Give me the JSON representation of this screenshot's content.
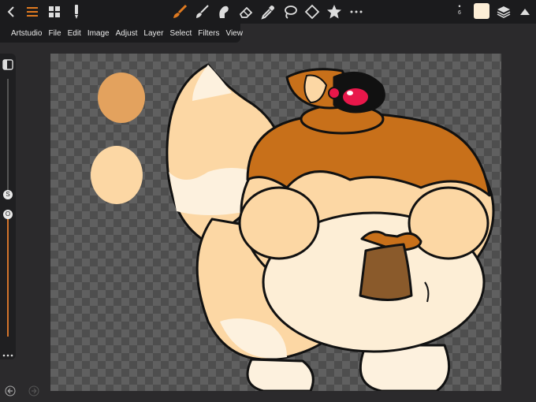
{
  "toolbar": {
    "tools": [
      "back-icon",
      "menu-icon",
      "grid-icon",
      "pencil-icon",
      "brush-icon",
      "paintbrush-icon",
      "smudge-icon",
      "eraser-icon",
      "eyedropper-icon",
      "lasso-icon",
      "transform-icon",
      "star-icon",
      "more-icon",
      "layers-icon",
      "collapse-icon"
    ],
    "brush_size": "6",
    "current_color": "#fdeed6",
    "accent": "#e07a20"
  },
  "menu": {
    "items": [
      "Artstudio",
      "File",
      "Edit",
      "Image",
      "Adjust",
      "Layer",
      "Select",
      "Filters",
      "View"
    ]
  },
  "side": {
    "size_value": "S",
    "opacity_value": "O",
    "accent": "#d3742b"
  },
  "canvas": {
    "swatch_colors": [
      "#e3a25e",
      "#fcd7a4"
    ]
  }
}
